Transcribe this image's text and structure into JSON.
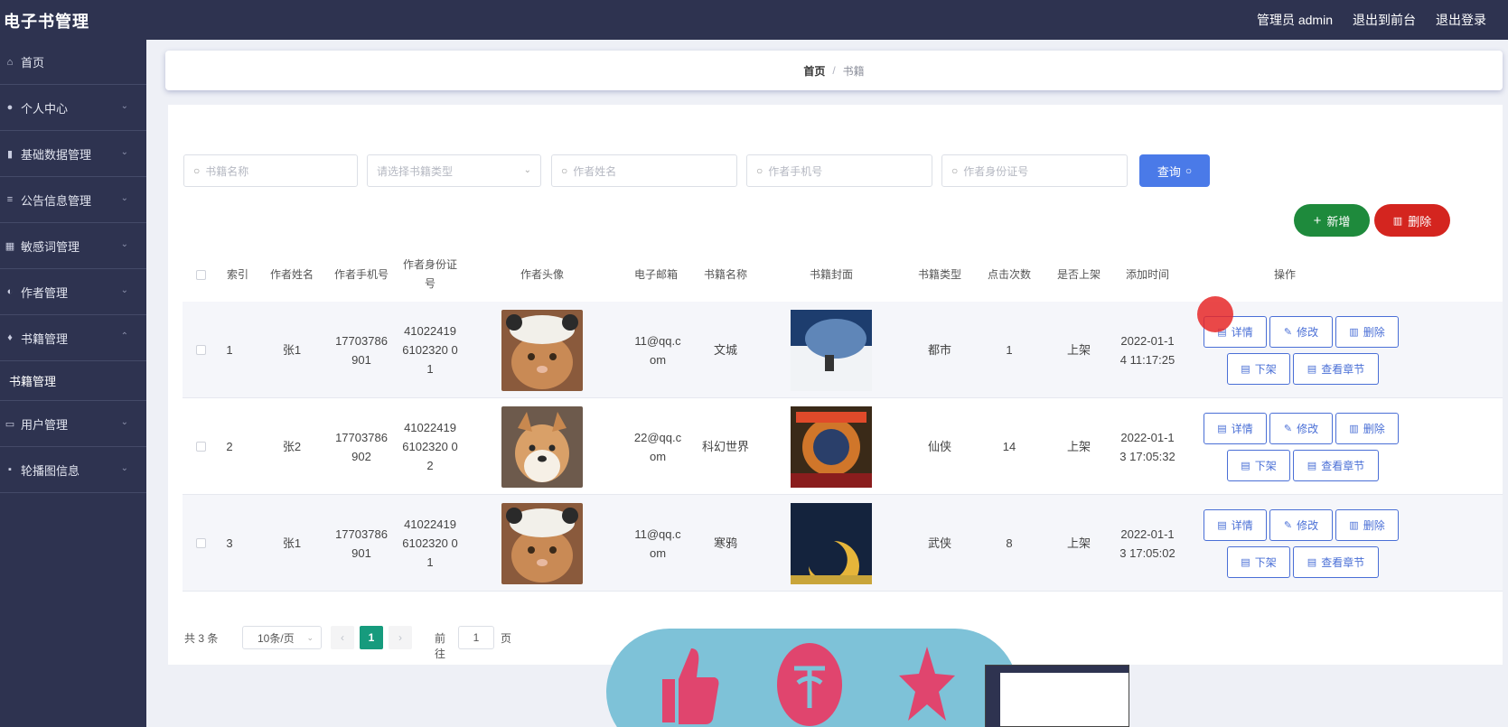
{
  "app": {
    "title": "电子书管理"
  },
  "top_links": [
    "管理员 admin",
    "退出到前台",
    "退出登录"
  ],
  "sidebar": {
    "items": [
      {
        "label": "首页",
        "icon": "home-icon"
      },
      {
        "label": "个人中心",
        "icon": "user-icon"
      },
      {
        "label": "基础数据管理",
        "icon": "bar-chart-icon"
      },
      {
        "label": "公告信息管理",
        "icon": "list-icon"
      },
      {
        "label": "敏感词管理",
        "icon": "keyboard-icon"
      },
      {
        "label": "作者管理",
        "icon": "mic-icon"
      },
      {
        "label": "书籍管理",
        "icon": "location-icon"
      },
      {
        "label": "用户管理",
        "icon": "folder-icon"
      },
      {
        "label": "轮播图信息",
        "icon": "grid-icon"
      }
    ],
    "sub_item": "书籍管理"
  },
  "breadcrumb": {
    "home": "首页",
    "sep": "/",
    "current": "书籍"
  },
  "search": {
    "book_name": "书籍名称",
    "book_type": "请选择书籍类型",
    "author_name": "作者姓名",
    "author_phone": "作者手机号",
    "author_id": "作者身份证号",
    "query_label": "查询"
  },
  "actions": {
    "add": "新增",
    "delete": "删除"
  },
  "table": {
    "headers": [
      "索引",
      "作者姓名",
      "作者手机号",
      "作者身份证号",
      "作者头像",
      "电子邮箱",
      "书籍名称",
      "书籍封面",
      "书籍类型",
      "点击次数",
      "是否上架",
      "添加时间",
      "操作"
    ],
    "rows": [
      {
        "index": "1",
        "author": "张1",
        "phone": "17703786901",
        "id_card": "410224196102320 01",
        "email": "11@qq.com",
        "book": "文城",
        "type": "都市",
        "clicks": "1",
        "on_shelf": "上架",
        "time": "2022-01-14 11:17:25"
      },
      {
        "index": "2",
        "author": "张2",
        "phone": "17703786902",
        "id_card": "410224196102320 02",
        "email": "22@qq.com",
        "book": "科幻世界",
        "type": "仙侠",
        "clicks": "14",
        "on_shelf": "上架",
        "time": "2022-01-13 17:05:32"
      },
      {
        "index": "3",
        "author": "张1",
        "phone": "17703786901",
        "id_card": "410224196102320 01",
        "email": "11@qq.com",
        "book": "寒鸦",
        "type": "武侠",
        "clicks": "8",
        "on_shelf": "上架",
        "time": "2022-01-13 17:05:02"
      }
    ],
    "row_actions": [
      "详情",
      "修改",
      "删除",
      "下架",
      "查看章节"
    ]
  },
  "pagination": {
    "total": "共 3 条",
    "page_size": "10条/页",
    "current": "1",
    "goto_prefix": "前往",
    "goto_value": "1",
    "goto_suffix": "页"
  },
  "colors": {
    "sidebar": "#2e3350",
    "primary": "#4a7ae8",
    "add": "#1e8a3c",
    "danger": "#d4251f",
    "page_active": "#169b7d"
  }
}
